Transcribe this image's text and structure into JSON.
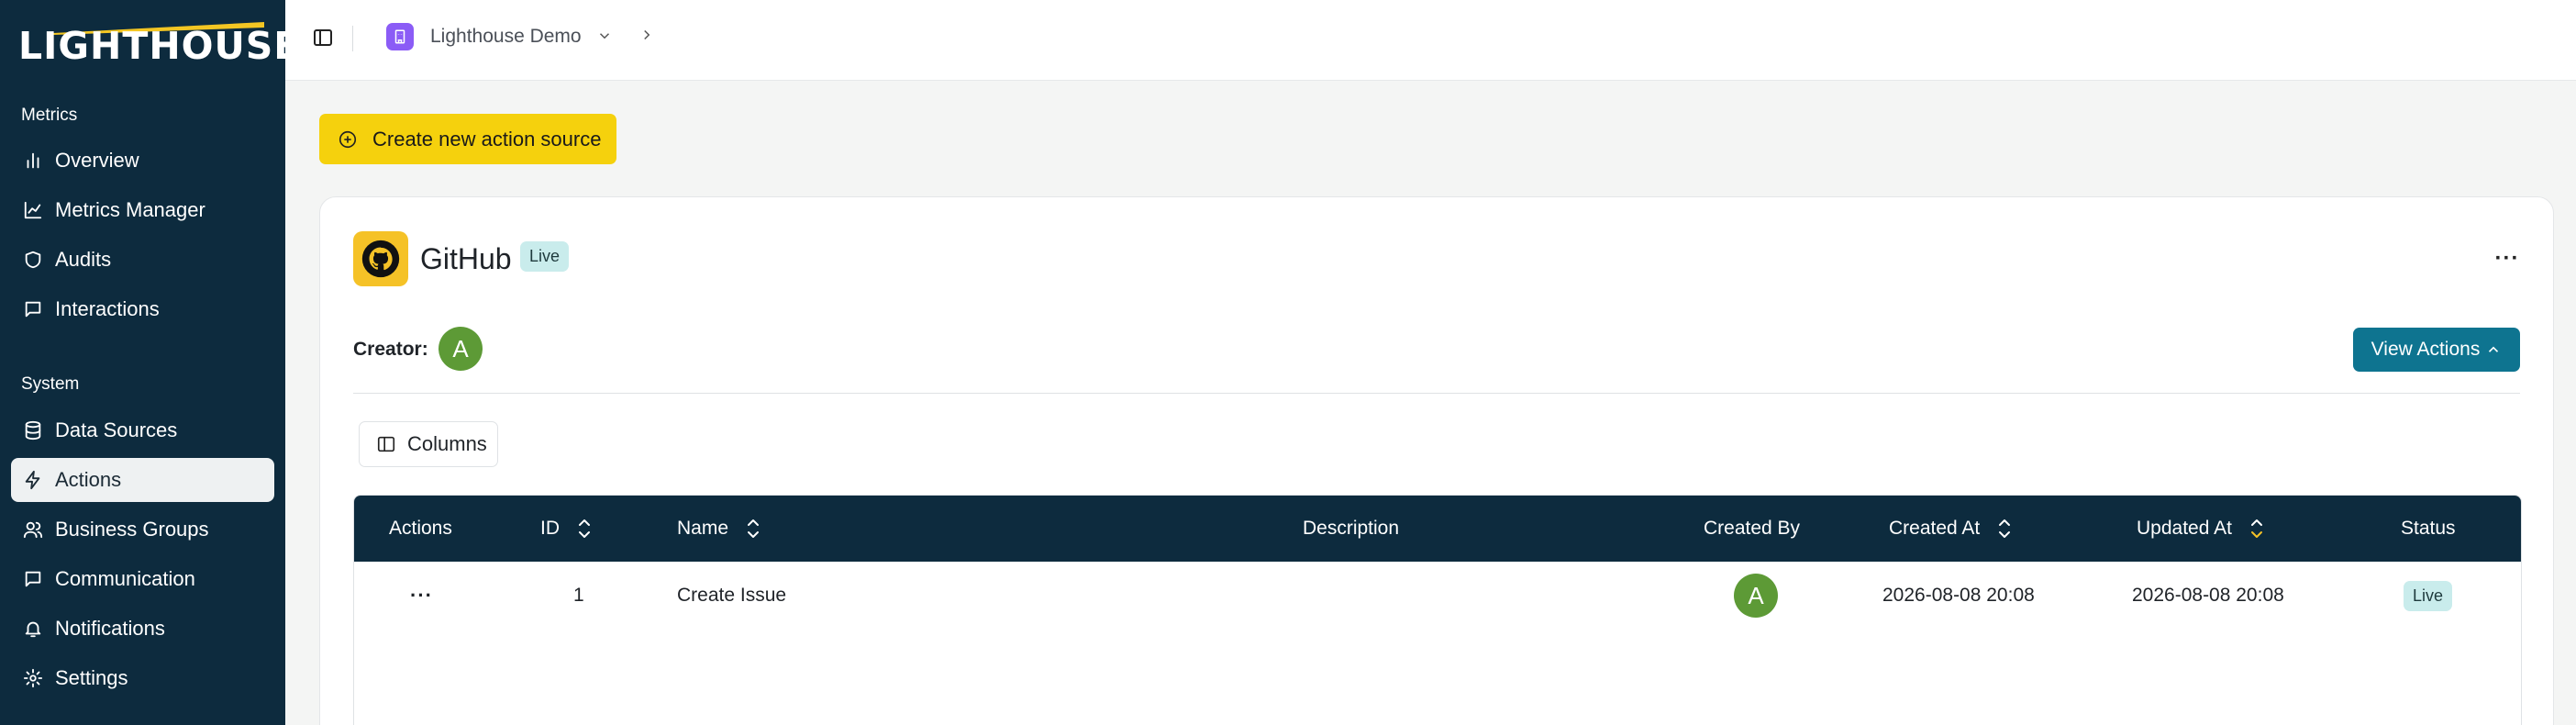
{
  "app": {
    "logo_text": "LIGHTHOUSE"
  },
  "sidebar": {
    "metrics_label": "Metrics",
    "system_label": "System",
    "metrics_items": [
      {
        "label": "Overview",
        "icon": "bar-chart-icon"
      },
      {
        "label": "Metrics Manager",
        "icon": "line-chart-icon"
      },
      {
        "label": "Audits",
        "icon": "shield-icon"
      },
      {
        "label": "Interactions",
        "icon": "message-icon"
      }
    ],
    "system_items": [
      {
        "label": "Data Sources",
        "icon": "database-icon"
      },
      {
        "label": "Actions",
        "icon": "zap-icon",
        "active": true
      },
      {
        "label": "Business Groups",
        "icon": "users-icon"
      },
      {
        "label": "Communication",
        "icon": "message-icon"
      },
      {
        "label": "Notifications",
        "icon": "bell-icon"
      },
      {
        "label": "Settings",
        "icon": "gear-icon"
      }
    ]
  },
  "topbar": {
    "project_name": "Lighthouse Demo"
  },
  "main": {
    "create_button_label": "Create new action source",
    "card": {
      "title": "GitHub",
      "status": "Live",
      "creator_label": "Creator:",
      "creator_initial": "A",
      "view_actions_label": "View Actions",
      "columns_label": "Columns",
      "more_label": "···"
    },
    "table": {
      "headers": {
        "actions": "Actions",
        "id": "ID",
        "name": "Name",
        "description": "Description",
        "created_by": "Created By",
        "created_at": "Created At",
        "updated_at": "Updated At",
        "status": "Status"
      },
      "rows": [
        {
          "actions": "···",
          "id": "1",
          "name": "Create Issue",
          "description": "",
          "created_by": "A",
          "created_at": "2026-08-08 20:08",
          "updated_at": "2026-08-08 20:08",
          "status": "Live"
        }
      ]
    }
  },
  "colors": {
    "sidebar_bg": "#0d2b3e",
    "accent_yellow": "#f5d10d",
    "primary_teal": "#0e7490",
    "badge_bg": "#c9ecec",
    "avatar_green": "#5d9a36",
    "project_purple": "#8b5cf6"
  }
}
